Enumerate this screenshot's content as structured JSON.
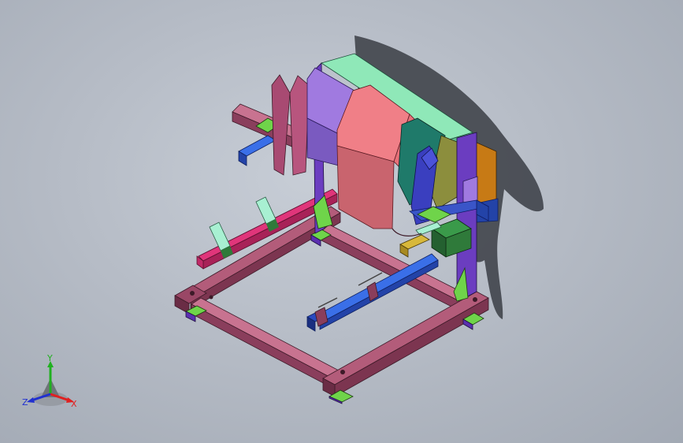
{
  "viewport": {
    "background_top": "#c7cdd6",
    "background_bottom": "#a2a9b4"
  },
  "model": {
    "colors": {
      "frame_rail": "#b35c7a",
      "frame_rail_dark": "#7c3550",
      "frame_rail_light": "#d48aa3",
      "foot": "#5b2fb0",
      "gusset_green": "#6fd44a",
      "cover_green": "#8fe8b8",
      "drum_purple": "#a07ae0",
      "drum_pink": "#f07f87",
      "drum_pink_dark": "#c9646e",
      "drum_teal": "#1f7a6a",
      "drum_olive": "#8c8e3d",
      "drum_orange": "#c77a15",
      "upright_purple": "#6b3dc0",
      "support_blue": "#3a55c8",
      "bright_blue": "#3a6fe8",
      "magenta_rail": "#e0357a",
      "clamp_mint": "#a8f0d2",
      "green_block": "#2f7a3a",
      "yellow_block": "#d8b83a",
      "shadow": "#3a3d44"
    }
  },
  "triad": {
    "x_label": "X",
    "y_label": "Y",
    "z_label": "Z",
    "x_color": "#e02020",
    "y_color": "#20b020",
    "z_color": "#2030d0"
  }
}
